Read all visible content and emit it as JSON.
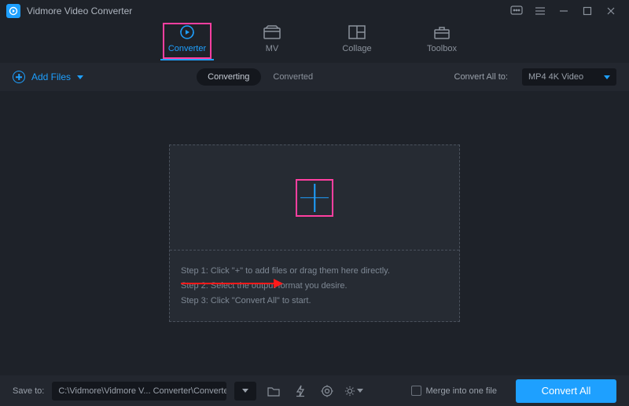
{
  "title": "Vidmore Video Converter",
  "tabs": [
    {
      "label": "Converter",
      "active": true
    },
    {
      "label": "MV"
    },
    {
      "label": "Collage"
    },
    {
      "label": "Toolbox"
    }
  ],
  "toolbar": {
    "add_label": "Add Files",
    "seg_converting": "Converting",
    "seg_converted": "Converted",
    "convert_all_label": "Convert All to:",
    "format": "MP4 4K Video"
  },
  "steps": {
    "s1": "Step 1: Click \"+\" to add files or drag them here directly.",
    "s2": "Step 2: Select the output format you desire.",
    "s3": "Step 3: Click \"Convert All\" to start."
  },
  "footer": {
    "save_label": "Save to:",
    "path": "C:\\Vidmore\\Vidmore V... Converter\\Converted",
    "merge_label": "Merge into one file",
    "cta": "Convert All"
  }
}
